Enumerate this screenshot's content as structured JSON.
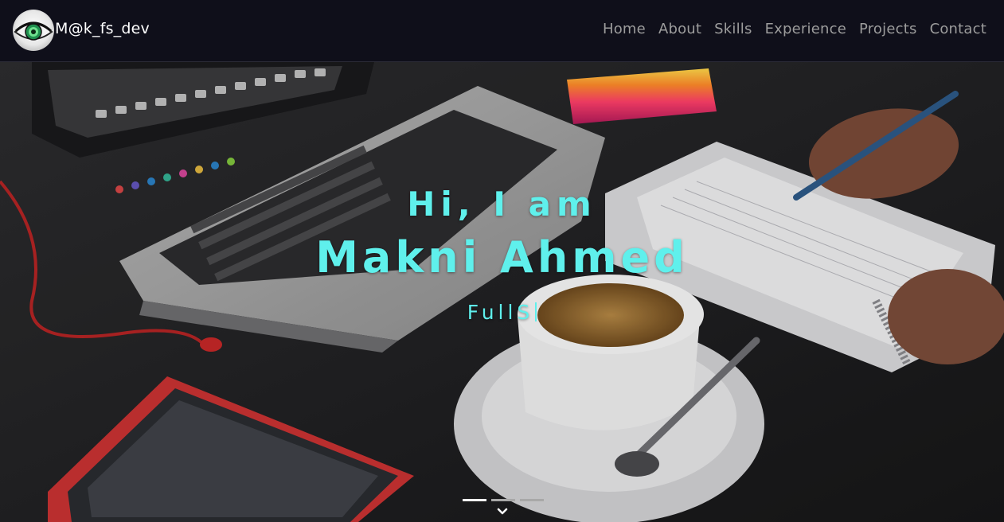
{
  "brand": {
    "text": "M@k_fs_dev",
    "logo_icon": "eye-icon"
  },
  "nav": {
    "links": [
      "Home",
      "About",
      "Skills",
      "Experience",
      "Projects",
      "Contact"
    ]
  },
  "hero": {
    "greeting": "Hi, I am",
    "name": "Makni Ahmed",
    "role_typed": "FullS",
    "slides": {
      "count": 3,
      "active_index": 0
    },
    "scroll_icon": "chevron-down-icon"
  },
  "colors": {
    "navbar_bg": "#0f0f1a",
    "nav_link": "#9c9c9c",
    "hero_accent": "#5ff0ec"
  }
}
